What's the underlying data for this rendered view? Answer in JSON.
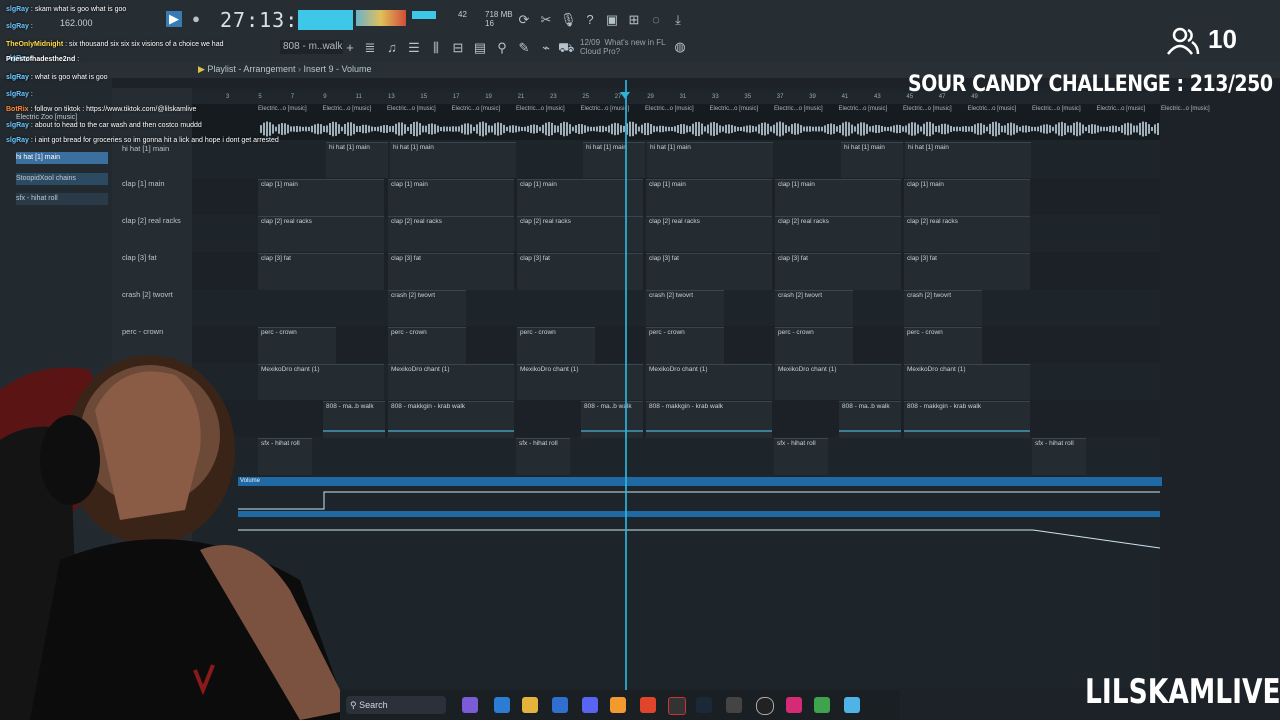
{
  "toolbar": {
    "tempo": "162.000",
    "time": "27:13:08",
    "cpu": "42",
    "memory": "718 MB",
    "memory_sub": "16",
    "pattern": "808 - m..walk",
    "news_date": "12/09",
    "news_title": "What's new in FL",
    "news_sub": "Cloud Pro?"
  },
  "playlist": {
    "title": "Playlist - Arrangement",
    "crumb": "Insert 9 - Volume",
    "ruler": [
      "3",
      "5",
      "7",
      "9",
      "11",
      "13",
      "15",
      "17",
      "19",
      "21",
      "23",
      "25",
      "27",
      "29",
      "31",
      "33",
      "35",
      "37",
      "39",
      "41",
      "43",
      "45",
      "47",
      "49"
    ],
    "audio_clip_label": "Electric...o [music]",
    "automation_label": "Volume"
  },
  "browser": {
    "items": [
      "Electric Zoo [music]",
      "hi hat [1] main",
      "StoopidXool chains",
      "sfx - hihat roll"
    ]
  },
  "tracks": [
    {
      "label": "hi hat [1] main",
      "clip": "hi hat [1] main"
    },
    {
      "label": "clap [1] main",
      "clip": "clap [1] main"
    },
    {
      "label": "clap [2] real racks",
      "clip": "clap [2] real racks"
    },
    {
      "label": "clap [3] fat",
      "clip": "clap [3] fat"
    },
    {
      "label": "crash [2] twovrt",
      "clip": "crash [2] twovrt"
    },
    {
      "label": "perc - crown",
      "clip": "perc - crown"
    },
    {
      "label": "(1)",
      "clip": "MexikoDro chant (1)"
    },
    {
      "label": "",
      "clip": "808 - makkgin - krab walk",
      "clip_short": "808 - ma..b walk"
    },
    {
      "label": "",
      "clip": "sfx - hihat roll"
    }
  ],
  "chat": [
    {
      "user": "slgRay",
      "text": "skam what is goo what is goo"
    },
    {
      "user": "slgRay",
      "text": ""
    },
    {
      "user": "TheOnlyMidnight",
      "text": "six thousand six six six visions of a choice we had"
    },
    {
      "user": "slgRay",
      "text": ""
    },
    {
      "user": "Priestofhadesthe2nd",
      "text": ""
    },
    {
      "user": "slgRay",
      "text": ""
    },
    {
      "user": "slgRay",
      "text": "what is goo what is goo"
    },
    {
      "user": "slgRay",
      "text": ""
    },
    {
      "user": "BotRix",
      "text": "follow on tiktok : https://www.tiktok.com/@lilskamlive"
    },
    {
      "user": "slgRay",
      "text": "about to head to the car wash and then costco muddd"
    },
    {
      "user": "slgRay",
      "text": "i aint got bread for groceries so im gonna hit a lick and hope i dont get arrested"
    }
  ],
  "taskbar": {
    "search_label": "Search"
  },
  "overlay": {
    "viewer_count": "10",
    "challenge": "SOUR CANDY CHALLENGE : 213/250",
    "brand": "LILSKAMLIVE"
  }
}
